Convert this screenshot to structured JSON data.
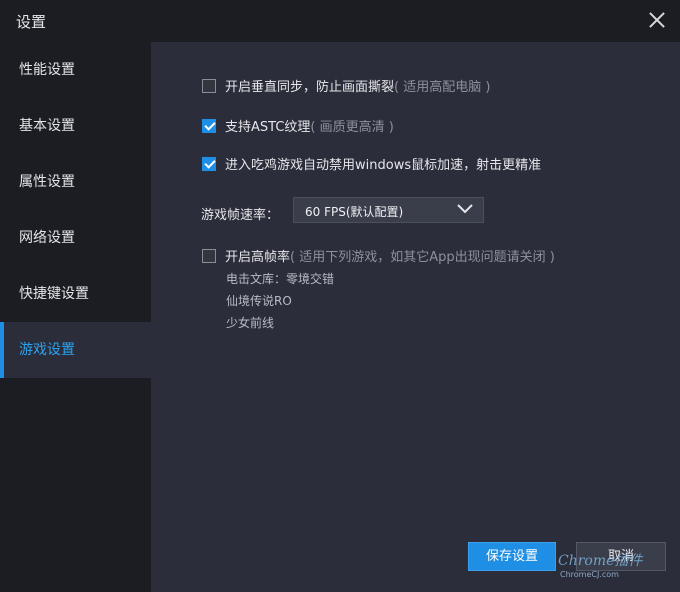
{
  "window": {
    "title": "设置"
  },
  "sidebar": {
    "items": [
      {
        "label": "性能设置"
      },
      {
        "label": "基本设置"
      },
      {
        "label": "属性设置"
      },
      {
        "label": "网络设置"
      },
      {
        "label": "快捷键设置"
      },
      {
        "label": "游戏设置"
      }
    ],
    "active_index": 5
  },
  "options": {
    "vsync": {
      "label": "开启垂直同步，防止画面撕裂",
      "hint": "( 适用高配电脑 )",
      "checked": false
    },
    "astc": {
      "label": "支持ASTC纹理",
      "hint": "( 画质更高清 )",
      "checked": true
    },
    "mouse_accel": {
      "label": "进入吃鸡游戏自动禁用windows鼠标加速，射击更精准",
      "checked": true
    },
    "high_fps": {
      "label": "开启高帧率",
      "hint": "( 适用下列游戏，如其它App出现问题请关闭 )",
      "checked": false
    }
  },
  "fps": {
    "label": "游戏帧速率：",
    "selected": "60 FPS(默认配置)"
  },
  "games": [
    "电击文库：零境交错",
    "仙境传说RO",
    "少女前线"
  ],
  "buttons": {
    "save": "保存设置",
    "cancel": "取消"
  },
  "watermark": {
    "line1": "Chrome插件",
    "line2": "ChromeCJ.com"
  },
  "colors": {
    "accent": "#1f8fe6",
    "active_text": "#2ba3f0",
    "content_bg": "#2b2d3a",
    "sidebar_bg": "#1c1d23"
  }
}
